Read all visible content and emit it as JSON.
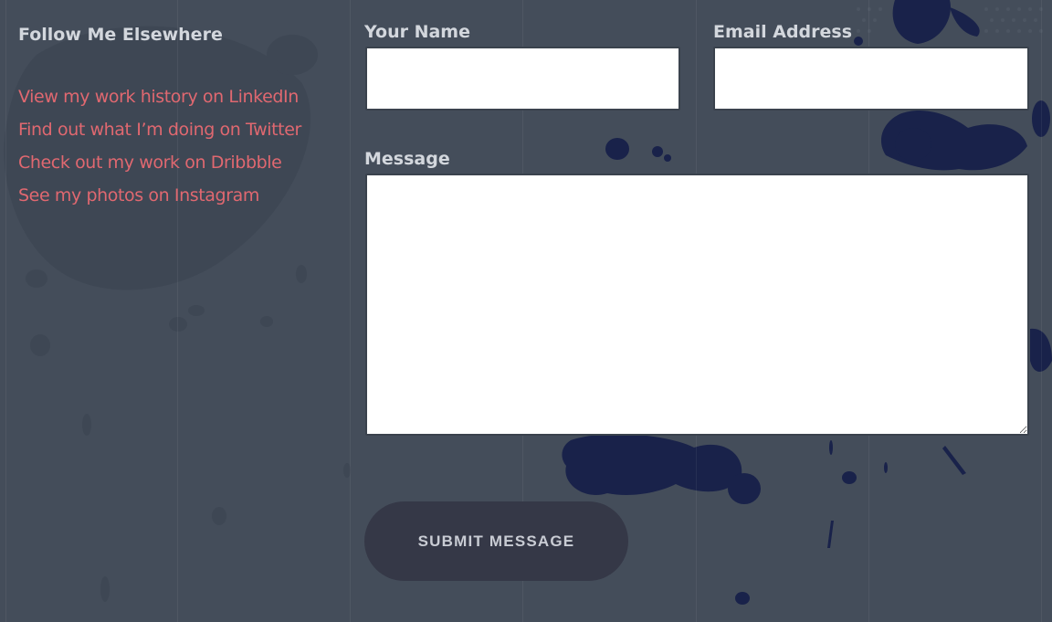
{
  "sidebar": {
    "heading": "Follow Me Elsewhere",
    "links": [
      {
        "label": "View my work history on LinkedIn"
      },
      {
        "label": "Find out what I’m doing on Twitter"
      },
      {
        "label": "Check out my work on Dribbble"
      },
      {
        "label": "See my photos on Instagram"
      }
    ]
  },
  "form": {
    "name_label": "Your Name",
    "name_value": "",
    "email_label": "Email Address",
    "email_value": "",
    "message_label": "Message",
    "message_value": "",
    "submit_label": "SUBMIT MESSAGE"
  },
  "colors": {
    "background": "#444d5a",
    "heading_text": "#d3d7dd",
    "link_text": "#e06870",
    "button_bg": "#353847",
    "button_text": "#c9ccd4",
    "splatter_dark": "#19224a",
    "splatter_light": "#3e4754"
  }
}
